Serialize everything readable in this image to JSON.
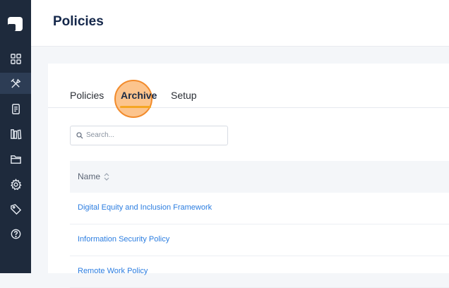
{
  "header": {
    "title": "Policies"
  },
  "tabs": [
    {
      "label": "Policies"
    },
    {
      "label": "Archive"
    },
    {
      "label": "Setup"
    }
  ],
  "active_tab": "Archive",
  "search": {
    "placeholder": "Search...",
    "value": ""
  },
  "table": {
    "columns": [
      {
        "label": "Name",
        "sortable": true
      }
    ],
    "rows": [
      {
        "name": "Digital Equity and Inclusion Framework"
      },
      {
        "name": "Information Security Policy"
      },
      {
        "name": "Remote Work Policy"
      }
    ]
  },
  "sidebar": {
    "items": [
      {
        "icon": "dashboard-grid-icon"
      },
      {
        "icon": "tools-icon",
        "active": true
      },
      {
        "icon": "document-icon"
      },
      {
        "icon": "library-icon"
      },
      {
        "icon": "folder-icon"
      },
      {
        "icon": "settings-gear-icon"
      },
      {
        "icon": "tag-icon"
      },
      {
        "icon": "help-icon"
      }
    ]
  },
  "colors": {
    "sidebar_bg": "#1e2a3c",
    "accent": "#f5a623",
    "link": "#2b7de0",
    "title": "#14274a"
  }
}
